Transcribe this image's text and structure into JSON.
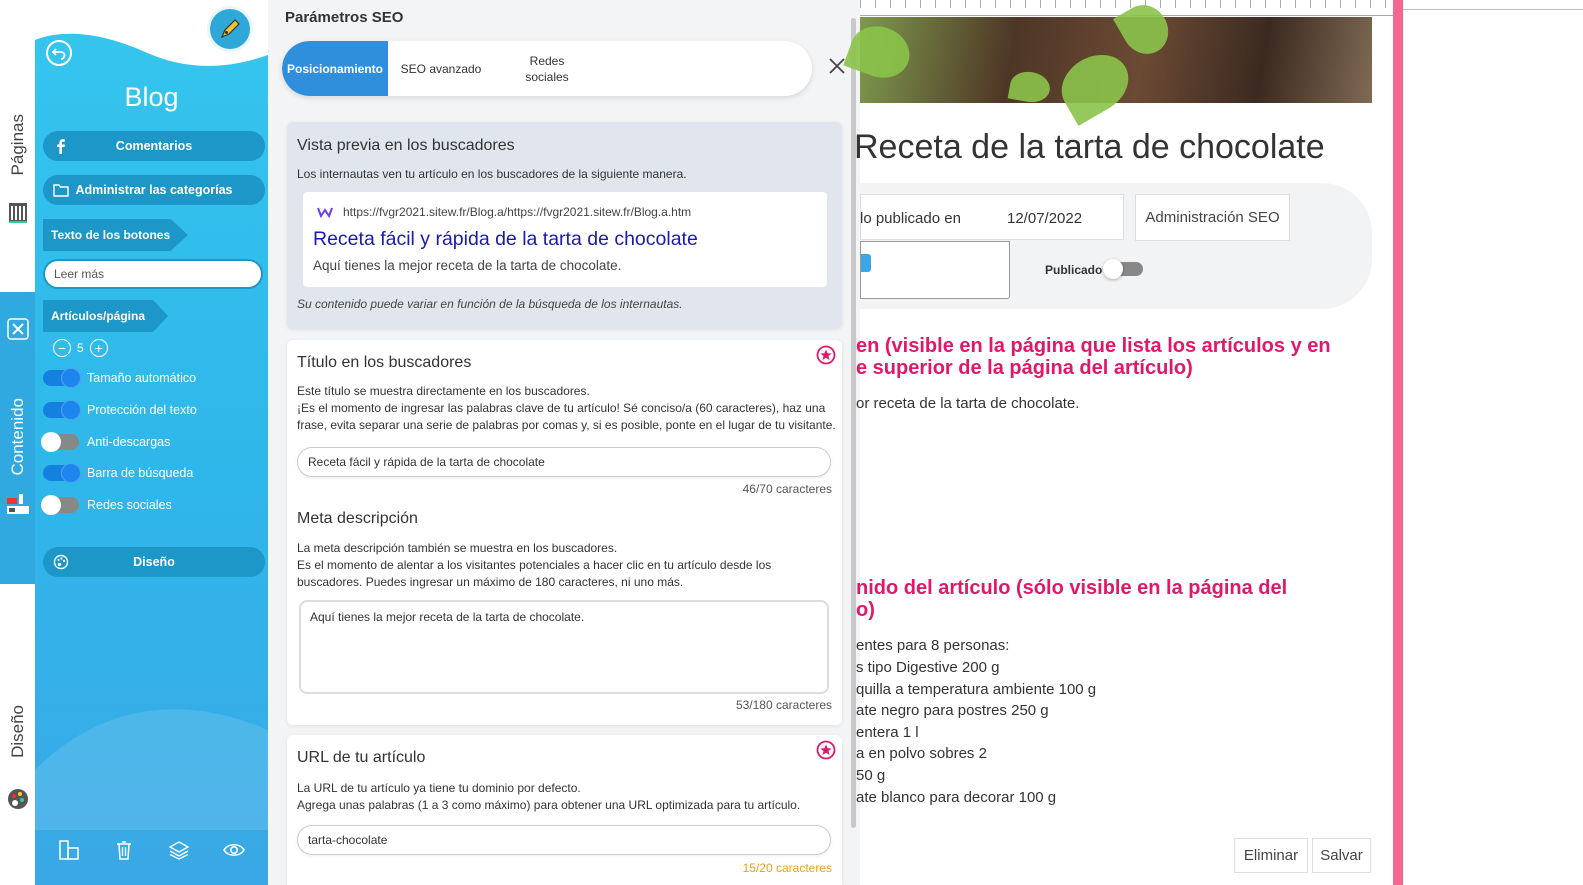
{
  "rail": {
    "tabs": [
      {
        "label": "Páginas"
      },
      {
        "label": "Contenido"
      },
      {
        "label": "Diseño"
      }
    ]
  },
  "sidebar": {
    "title": "Blog",
    "buttons": {
      "comments": "Comentarios",
      "categories": "Administrar las categorías",
      "design": "Diseño"
    },
    "button_text_label": "Texto de los botones",
    "read_more_value": "Leer más",
    "articles_per_page_label": "Artículos/página",
    "articles_per_page_value": "5",
    "toggles": [
      {
        "label": "Tamaño automático",
        "on": true
      },
      {
        "label": "Protección del texto",
        "on": true
      },
      {
        "label": "Anti-descargas",
        "on": false
      },
      {
        "label": "Barra de búsqueda",
        "on": true
      },
      {
        "label": "Redes sociales",
        "on": false
      }
    ]
  },
  "seo": {
    "header": "Parámetros SEO",
    "tabs": [
      "Posicionamiento",
      "SEO avanzado",
      "Redes sociales"
    ],
    "preview": {
      "heading": "Vista previa en los buscadores",
      "intro": "Los internautas ven tu artículo en los buscadores de la siguiente manera.",
      "url": "https://fvgr2021.sitew.fr/Blog.a/https://fvgr2021.sitew.fr/Blog.a.htm",
      "title": "Receta fácil y rápida de la tarta de chocolate",
      "description": "Aquí tienes la mejor receta de la tarta de chocolate.",
      "note": "Su contenido puede variar en función de la búsqueda de los internautas."
    },
    "title_card": {
      "heading": "Título en los buscadores",
      "line1": "Este título se muestra directamente en los buscadores.",
      "line2": "¡Es el momento de ingresar las palabras clave de tu artículo! Sé conciso/a (60 caracteres), haz una",
      "line3": "frase, evita separar una serie de palabras por comas y, si es posible, ponte en el lugar de tu visitante.",
      "value": "Receta fácil y rápida de la tarta de chocolate",
      "counter": "46/70 caracteres",
      "meta_heading": "Meta descripción",
      "meta_line1": "La meta descripción también se muestra en los buscadores.",
      "meta_line2": "Es el momento de alentar a los visitantes potenciales a hacer clic en tu artículo desde los",
      "meta_line3": "buscadores. Puedes ingresar un máximo de 180 caracteres, ni uno más.",
      "meta_value": "Aquí tienes la mejor receta de la tarta de chocolate.",
      "meta_counter": "53/180 caracteres"
    },
    "url_card": {
      "heading": "URL de tu artículo",
      "line1": "La URL de tu artículo ya tiene tu dominio por defecto.",
      "line2": "Agrega unas palabras (1 a 3 como máximo) para obtener una URL optimizada para tu artículo.",
      "value": "tarta-chocolate",
      "counter": "15/20 caracteres"
    }
  },
  "page": {
    "title": "Receta de la tarta de chocolate",
    "published_label": "lo publicado en",
    "date": "12/07/2022",
    "seo_admin": "Administración SEO",
    "published_toggle_label": "Publicado",
    "summary_heading_1": "en (visible en la página que lista los artículos y en",
    "summary_heading_2": "e superior de la página del artículo)",
    "summary_text": "or receta de la tarta de chocolate.",
    "content_heading_1": "nido del artículo (sólo visible en la página del",
    "content_heading_2": "o)",
    "content_lines": [
      "entes para 8 personas:",
      "s tipo Digestive 200 g",
      "quilla a temperatura ambiente 100 g",
      "ate negro para postres 250 g",
      "entera 1 l",
      "a en polvo sobres 2",
      "50 g",
      "ate blanco para decorar 100 g"
    ],
    "delete": "Eliminar",
    "save": "Salvar"
  },
  "colors": {
    "sidebar": "#35c6ee",
    "active_tab": "#2f8fdc",
    "pink_accent": "#e0186b"
  }
}
